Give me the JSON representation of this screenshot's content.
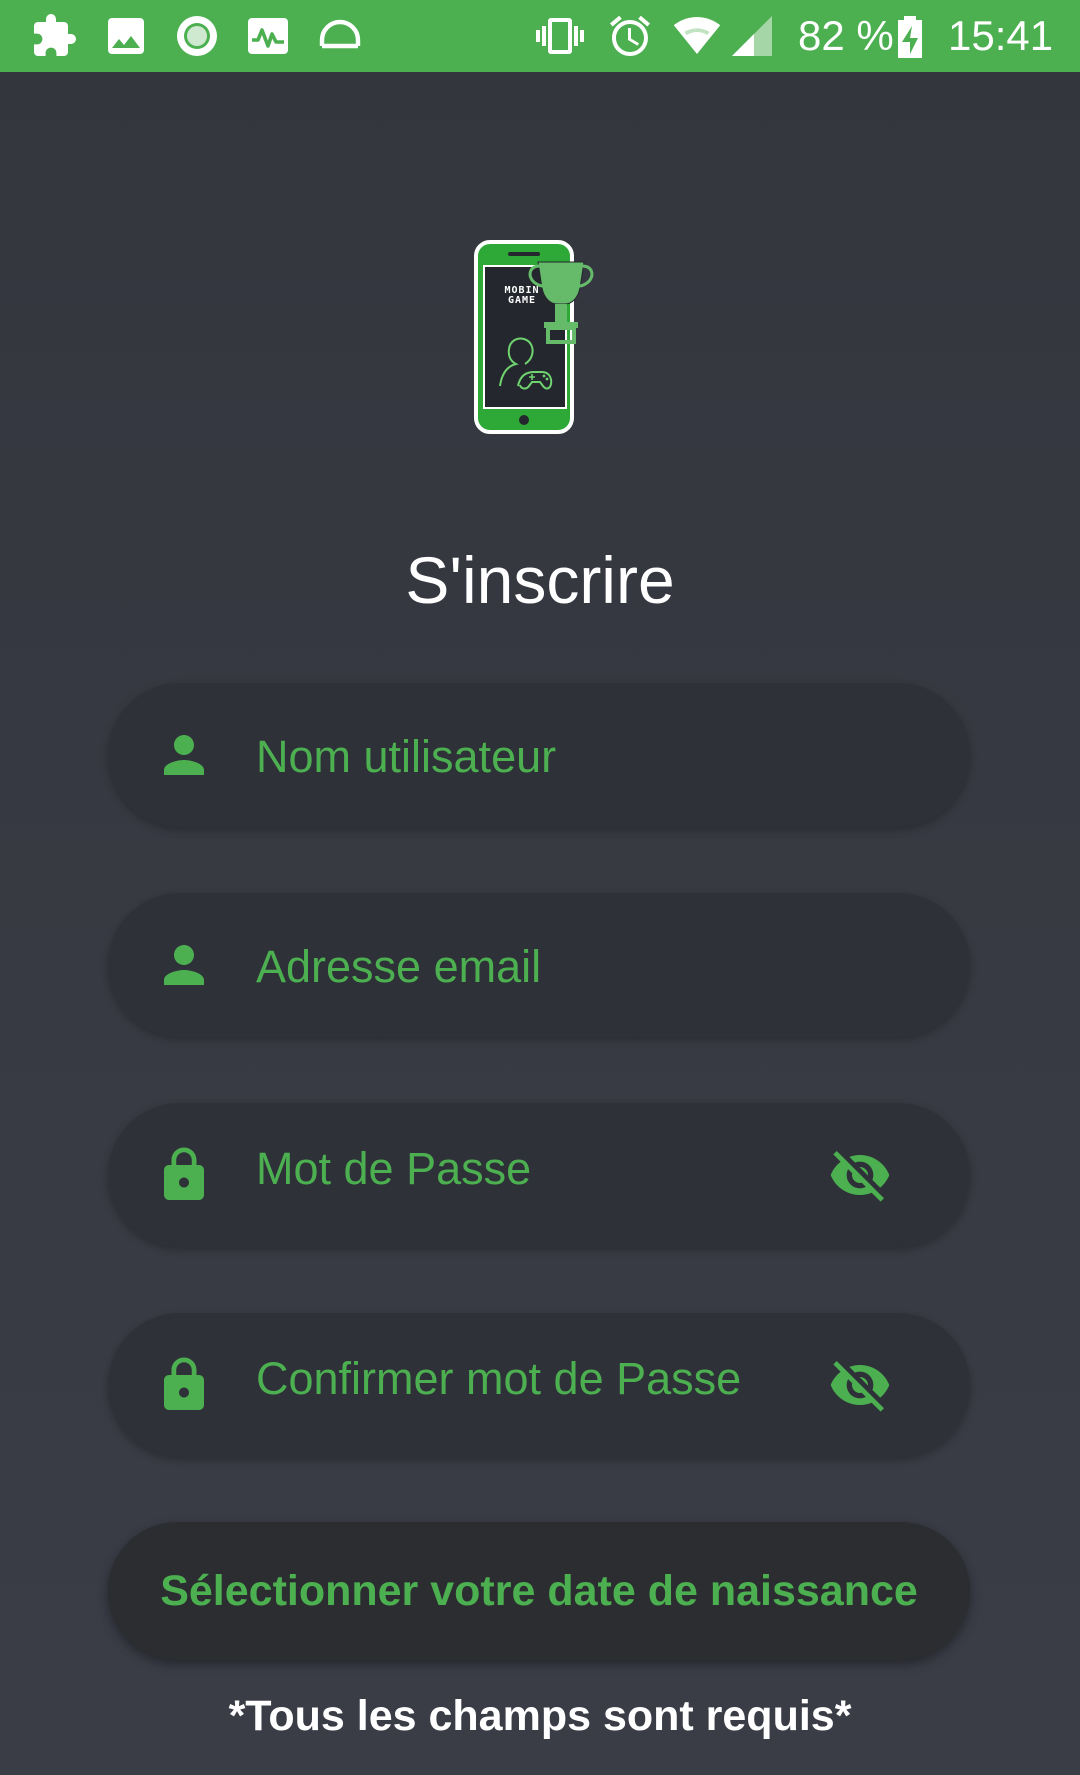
{
  "status_bar": {
    "background": "#4caf50",
    "left_icons": [
      "puzzle-icon",
      "image-icon",
      "record-icon",
      "activity-icon",
      "headset-icon"
    ],
    "right_icons": [
      "vibrate-icon",
      "alarm-icon",
      "wifi-icon",
      "cell-signal-icon",
      "battery-charging-icon"
    ],
    "battery_percent": "82 %",
    "time": "15:41"
  },
  "logo": {
    "caption": "MOBIN GAME",
    "icon": "phone-trophy-gamer-logo"
  },
  "title": "S'inscrire",
  "form": {
    "fields": [
      {
        "name": "username",
        "icon": "person-icon",
        "placeholder": "Nom utilisateur",
        "password_toggle": false
      },
      {
        "name": "email",
        "icon": "person-icon",
        "placeholder": "Adresse email",
        "password_toggle": false
      },
      {
        "name": "password",
        "icon": "lock-icon",
        "placeholder": "Mot de Passe",
        "password_toggle": true,
        "toggle_icon": "eye-off-icon"
      },
      {
        "name": "confirm_password",
        "icon": "lock-icon",
        "placeholder": "Confirmer mot de Passe",
        "password_toggle": true,
        "toggle_icon": "eye-off-icon"
      }
    ],
    "date_button_label": "Sélectionner votre date de naissance",
    "required_note": "*Tous les champs sont requis*"
  },
  "colors": {
    "accent": "#4caf50",
    "background": "#35383f",
    "field_background": "#2f3139",
    "button_background": "#2c2d31",
    "text": "#ffffff"
  }
}
